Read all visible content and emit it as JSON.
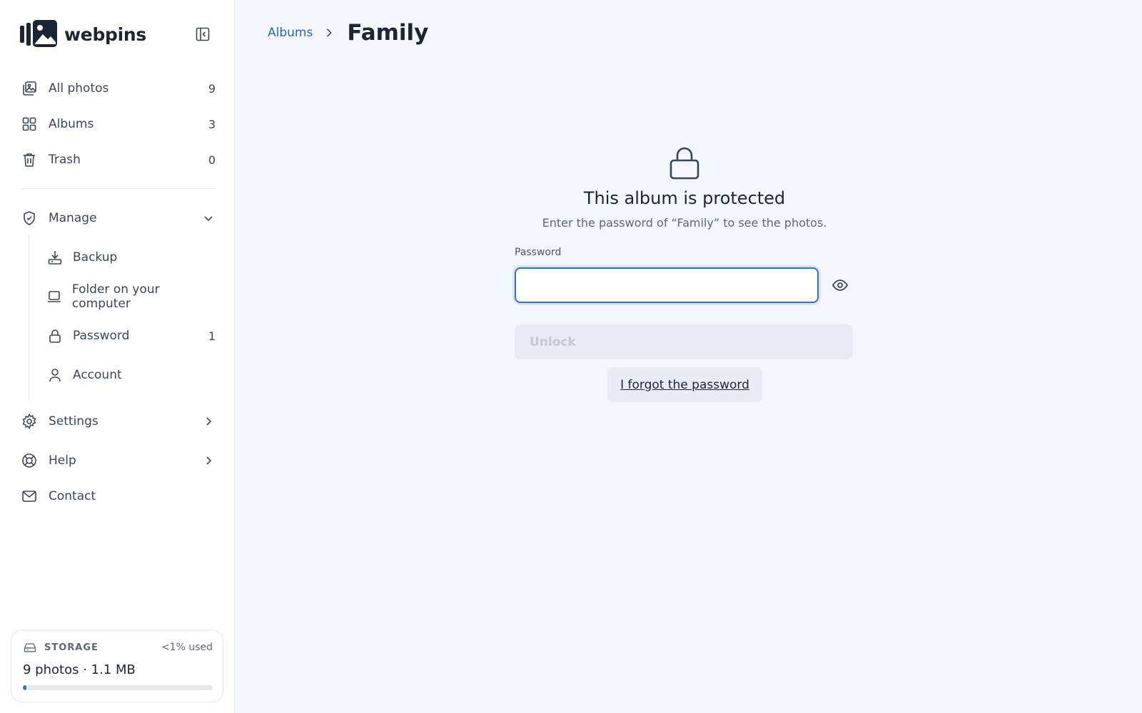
{
  "app": {
    "name": "webpins"
  },
  "sidebar": {
    "nav": [
      {
        "label": "All photos",
        "count": "9",
        "icon": "photos-icon"
      },
      {
        "label": "Albums",
        "count": "3",
        "icon": "grid-icon"
      },
      {
        "label": "Trash",
        "count": "0",
        "icon": "trash-icon"
      }
    ],
    "manage": {
      "label": "Manage",
      "icon": "shield-check-icon",
      "items": [
        {
          "label": "Backup",
          "count": "",
          "icon": "download-tray-icon"
        },
        {
          "label": "Folder on your computer",
          "count": "",
          "icon": "laptop-icon"
        },
        {
          "label": "Password",
          "count": "1",
          "icon": "lock-icon"
        },
        {
          "label": "Account",
          "count": "",
          "icon": "user-icon"
        }
      ]
    },
    "settings": {
      "label": "Settings",
      "icon": "gear-icon"
    },
    "help": {
      "label": "Help",
      "icon": "lifebuoy-icon"
    },
    "contact": {
      "label": "Contact",
      "icon": "mail-icon"
    },
    "storage": {
      "title": "STORAGE",
      "used_label": "<1% used",
      "summary": "9 photos · 1.1 MB",
      "used_fraction": 0.01
    }
  },
  "main": {
    "breadcrumb": {
      "parent": "Albums",
      "current": "Family"
    },
    "protected": {
      "title": "This album is protected",
      "subtitle": "Enter the password of “Family” to see the photos.",
      "password_label": "Password",
      "password_value": "",
      "unlock_label": "Unlock",
      "forgot_label": "I forgot the password"
    }
  },
  "colors": {
    "accent": "#2f6fdc",
    "link": "#2c63b5",
    "background": "#f3f6fa"
  }
}
